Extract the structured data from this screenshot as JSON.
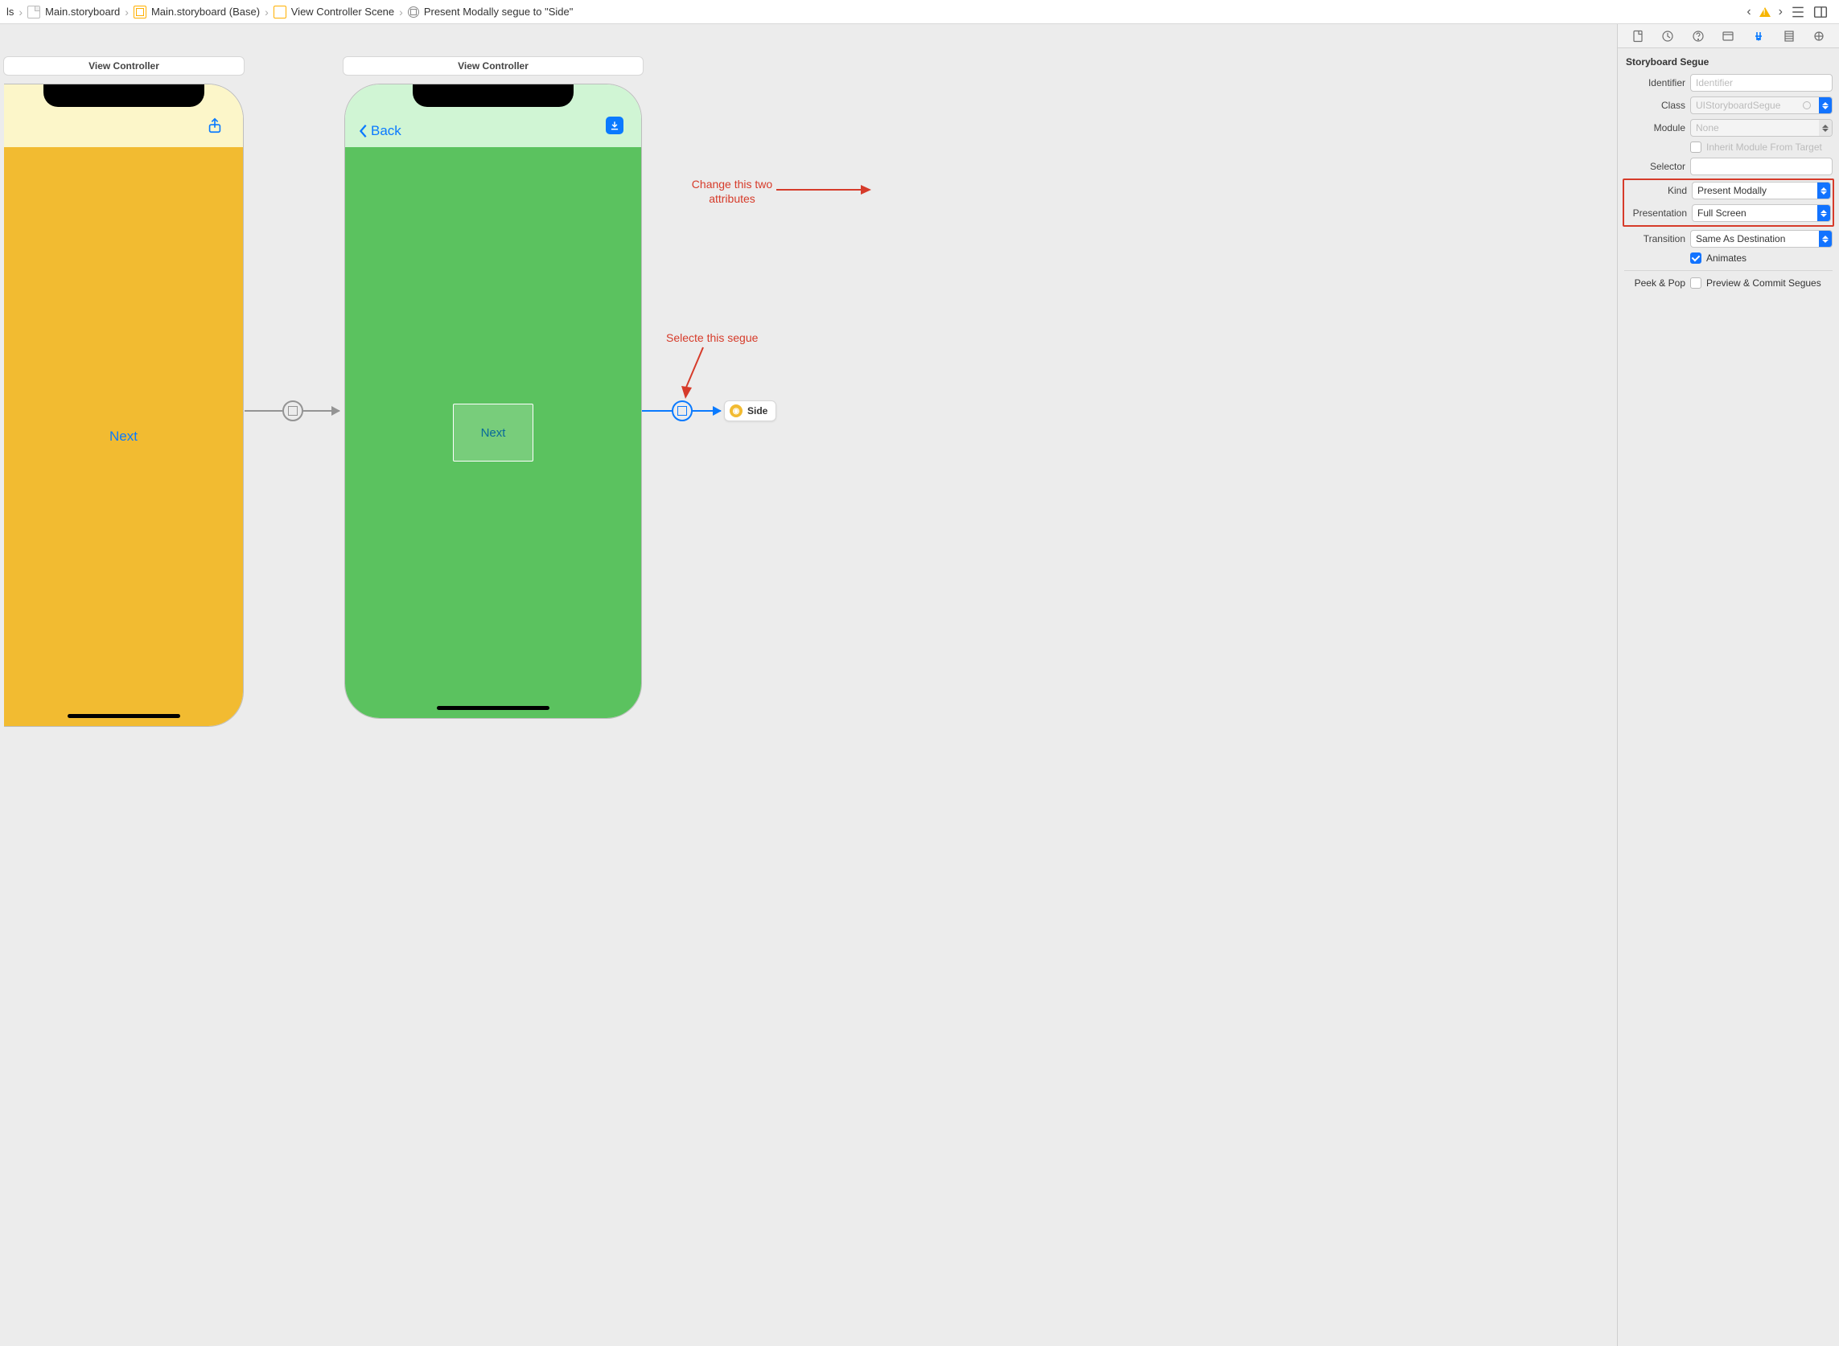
{
  "breadcrumb": {
    "items": [
      {
        "label": "ls"
      },
      {
        "label": "Main.storyboard"
      },
      {
        "label": "Main.storyboard (Base)"
      },
      {
        "label": "View Controller Scene"
      },
      {
        "label": "Present Modally segue to \"Side\""
      }
    ]
  },
  "canvas": {
    "vc1": {
      "title": "View Controller",
      "next_label": "Next"
    },
    "vc2": {
      "title": "View Controller",
      "back_label": "Back",
      "next_label": "Next"
    },
    "side_chip": "Side",
    "annotation1_line1": "Change this two",
    "annotation1_line2": "attributes",
    "annotation2": "Selecte this segue"
  },
  "inspector": {
    "heading": "Storyboard Segue",
    "identifier": {
      "label": "Identifier",
      "placeholder": "Identifier",
      "value": ""
    },
    "class": {
      "label": "Class",
      "value": "UIStoryboardSegue"
    },
    "module": {
      "label": "Module",
      "value": "None"
    },
    "inherit": {
      "label": "Inherit Module From Target",
      "checked": false
    },
    "selector": {
      "label": "Selector",
      "value": ""
    },
    "kind": {
      "label": "Kind",
      "value": "Present Modally"
    },
    "presentation": {
      "label": "Presentation",
      "value": "Full Screen"
    },
    "transition": {
      "label": "Transition",
      "value": "Same As Destination"
    },
    "animates": {
      "label": "Animates",
      "checked": true
    },
    "peek": {
      "label": "Peek & Pop",
      "option": "Preview & Commit Segues",
      "checked": false
    }
  }
}
